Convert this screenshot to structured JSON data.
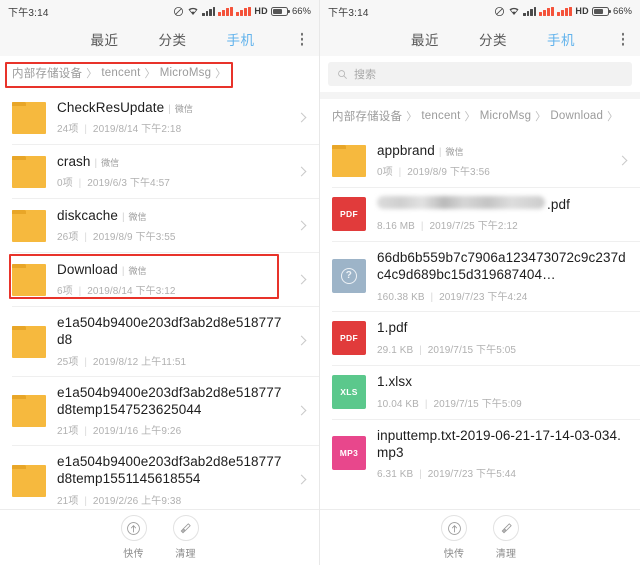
{
  "status_bar": {
    "time": "下午3:14",
    "hd_label": "HD",
    "battery_percent": "66%",
    "icons": [
      "mute-icon",
      "wifi-icon",
      "signal-icon",
      "sim1-icon",
      "sim2-icon",
      "battery-icon"
    ]
  },
  "tabs": [
    {
      "label": "最近",
      "active": false
    },
    {
      "label": "分类",
      "active": false
    },
    {
      "label": "手机",
      "active": true
    }
  ],
  "more_menu_label": "更多",
  "colors": {
    "accent_tab": "#62b3ec",
    "folder": "#f6b93e",
    "pdf": "#e13b3b",
    "unknown": "#9db4c8",
    "xls": "#5bc88c",
    "mp3": "#e8478c",
    "annotation": "#e8332a",
    "status_sim": "#f4523a"
  },
  "left_panel": {
    "breadcrumb": [
      "内部存储设备",
      "tencent",
      "MicroMsg"
    ],
    "breadcrumb_separator": "〉",
    "items": [
      {
        "icon": "folder-icon",
        "kind": "folder",
        "name": "CheckResUpdate",
        "tag": "微信",
        "count": "24项",
        "date": "2019/8/14 下午2:18",
        "highlighted": false
      },
      {
        "icon": "folder-icon",
        "kind": "folder",
        "name": "crash",
        "tag": "微信",
        "count": "0项",
        "date": "2019/6/3 下午4:57",
        "highlighted": false
      },
      {
        "icon": "folder-icon",
        "kind": "folder",
        "name": "diskcache",
        "tag": "微信",
        "count": "26项",
        "date": "2019/8/9 下午3:55",
        "highlighted": false
      },
      {
        "icon": "folder-icon",
        "kind": "folder",
        "name": "Download",
        "tag": "微信",
        "count": "6项",
        "date": "2019/8/14 下午3:12",
        "highlighted": true
      },
      {
        "icon": "folder-icon",
        "kind": "folder",
        "name": "e1a504b9400e203df3ab2d8e518777d8",
        "tag": "",
        "count": "25项",
        "date": "2019/8/12 上午11:51",
        "highlighted": false
      },
      {
        "icon": "folder-icon",
        "kind": "folder",
        "name": "e1a504b9400e203df3ab2d8e518777d8temp1547523625044",
        "tag": "",
        "count": "21项",
        "date": "2019/1/16 上午9:26",
        "highlighted": false
      },
      {
        "icon": "folder-icon",
        "kind": "folder",
        "name": "e1a504b9400e203df3ab2d8e518777d8temp1551145618554",
        "tag": "",
        "count": "21项",
        "date": "2019/2/26 上午9:38",
        "highlighted": false
      }
    ]
  },
  "right_panel": {
    "search_placeholder": "搜索",
    "breadcrumb": [
      "内部存储设备",
      "tencent",
      "MicroMsg",
      "Download"
    ],
    "breadcrumb_separator": "〉",
    "items": [
      {
        "icon": "folder-icon",
        "kind": "folder",
        "name": "appbrand",
        "tag": "微信",
        "count": "0项",
        "date": "2019/8/9 下午3:56",
        "chevron": true
      },
      {
        "icon": "pdf-file-icon",
        "kind": "pdf",
        "badge": "PDF",
        "name": ".pdf",
        "name_redacted": true,
        "tag": "",
        "count": "8.16 MB",
        "date": "2019/7/25 下午2:12",
        "chevron": false
      },
      {
        "icon": "unknown-file-icon",
        "kind": "unknown",
        "badge": "?",
        "name": "66db6b559b7c7906a123473072c9c237dc4c9d689bc15d319687404…",
        "tag": "",
        "count": "160.38 KB",
        "date": "2019/7/23 下午4:24",
        "chevron": false
      },
      {
        "icon": "pdf-file-icon",
        "kind": "pdf",
        "badge": "PDF",
        "name": "1.pdf",
        "tag": "",
        "count": "29.1 KB",
        "date": "2019/7/15 下午5:05",
        "chevron": false
      },
      {
        "icon": "xls-file-icon",
        "kind": "xls",
        "badge": "XLS",
        "name": "1.xlsx",
        "tag": "",
        "count": "10.04 KB",
        "date": "2019/7/15 下午5:09",
        "chevron": false
      },
      {
        "icon": "mp3-file-icon",
        "kind": "mp3",
        "badge": "MP3",
        "name": "inputtemp.txt-2019-06-21-17-14-03-034.mp3",
        "tag": "",
        "count": "6.31 KB",
        "date": "2019/7/23 下午5:44",
        "chevron": false
      }
    ]
  },
  "bottom_bar": {
    "actions": [
      {
        "icon": "quick-transfer-icon",
        "label": "快传"
      },
      {
        "icon": "clean-broom-icon",
        "label": "清理"
      }
    ]
  },
  "annotations": [
    {
      "name": "breadcrumb-highlight",
      "target": "left breadcrumb"
    },
    {
      "name": "download-row-highlight",
      "target": "left Download row"
    }
  ]
}
